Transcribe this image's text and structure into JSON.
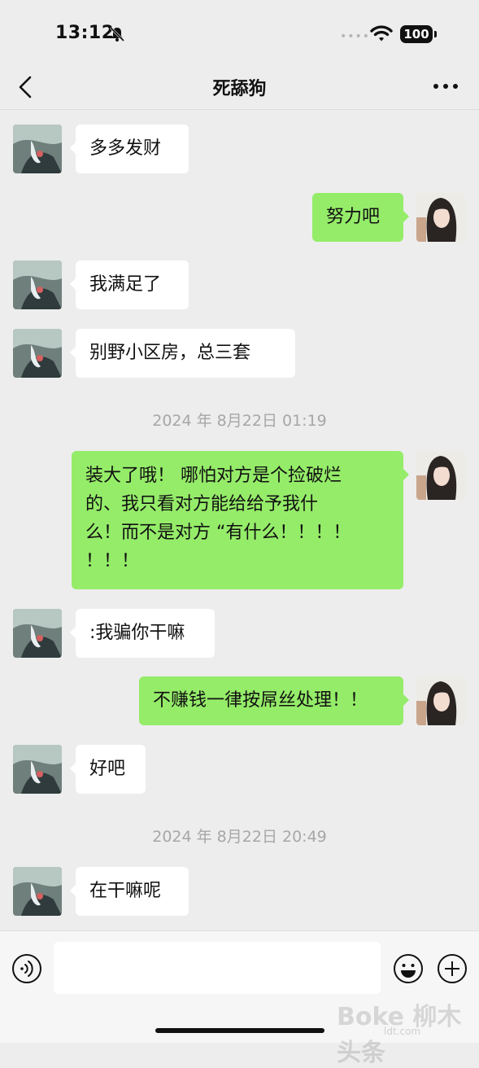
{
  "status_bar": {
    "time": "13:12",
    "battery": "100",
    "signal_dots": "••••"
  },
  "nav": {
    "title": "死舔狗"
  },
  "messages": [
    {
      "side": "in",
      "text": "多多发财"
    },
    {
      "side": "out",
      "text": "努力吧"
    },
    {
      "side": "in",
      "text": "我满足了"
    },
    {
      "side": "in",
      "text": "别野小区房，总三套"
    },
    {
      "timestamp": "2024 年 8月22日 01:19"
    },
    {
      "side": "out",
      "lines": [
        "装大了哦！ 哪怕对方是个捡破烂",
        "的、我只看对方能给给予我什",
        "么！而不是对方 “有什么！！！！",
        "！！！"
      ]
    },
    {
      "side": "in",
      "text": ":我骗你干嘛"
    },
    {
      "side": "out",
      "text": "不赚钱一律按屌丝处理！！"
    },
    {
      "side": "in",
      "text": "好吧"
    },
    {
      "timestamp": "2024 年 8月22日 20:49"
    },
    {
      "side": "in",
      "text": "在干嘛呢"
    }
  ],
  "watermark": {
    "text": "Boke 柳木头条",
    "sub": "ldt.com"
  }
}
